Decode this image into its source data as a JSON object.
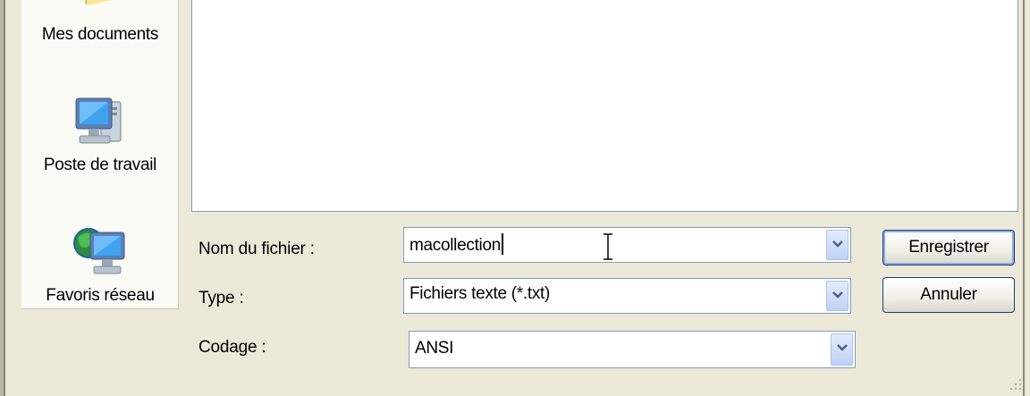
{
  "places": [
    {
      "label": "Mes documents",
      "icon": "my-documents-folder-icon"
    },
    {
      "label": "Poste de travail",
      "icon": "my-computer-icon"
    },
    {
      "label": "Favoris réseau",
      "icon": "network-places-icon"
    }
  ],
  "form": {
    "filename_label": "Nom du fichier :",
    "filename_value": "macollection",
    "type_label": "Type :",
    "type_value": "Fichiers texte (*.txt)",
    "encoding_label": "Codage :",
    "encoding_value": "ANSI"
  },
  "buttons": {
    "save": "Enregistrer",
    "cancel": "Annuler"
  },
  "colors": {
    "dialog_bg": "#ece9d8",
    "field_border": "#7f9db9",
    "button_border": "#1f3b7a"
  }
}
